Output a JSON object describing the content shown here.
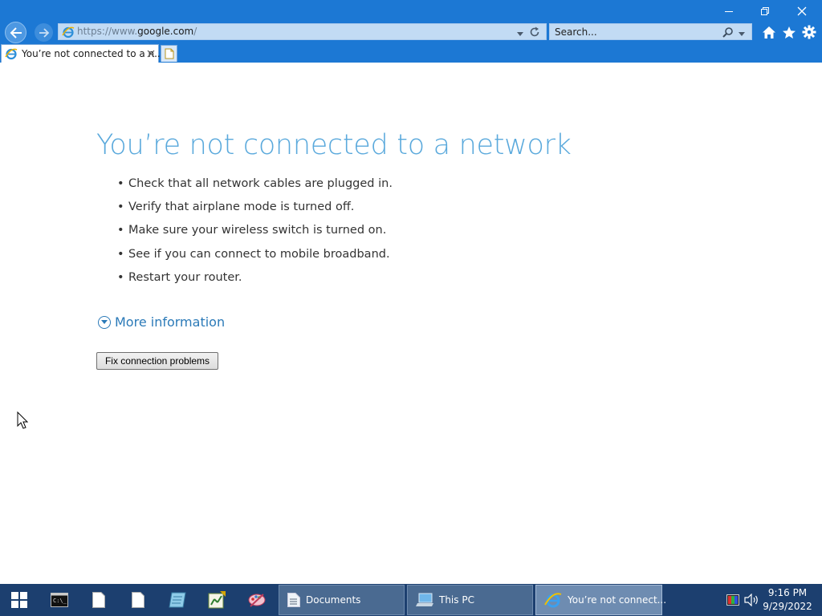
{
  "window": {
    "minimize_icon": "minimize-icon",
    "restore_icon": "restore-icon",
    "close_icon": "close-icon"
  },
  "toolbar": {
    "url_scheme": "https://www.",
    "url_host": "google.com",
    "url_path": "/",
    "search_placeholder": "Search...",
    "icons": [
      "back-arrow-icon",
      "forward-arrow-icon",
      "ie-icon",
      "dropdown-icon",
      "refresh-icon",
      "search-icon",
      "home-icon",
      "favorites-star-icon",
      "gear-icon"
    ]
  },
  "tab": {
    "label": "You’re not connected to a n...",
    "close_icon": "close-icon",
    "new_tab_icon": "new-tab-icon"
  },
  "page": {
    "title": "You’re not connected to a network",
    "tips": [
      "Check that all network cables are plugged in.",
      "Verify that airplane mode is turned off.",
      "Make sure your wireless switch is turned on.",
      "See if you can connect to mobile broadband.",
      "Restart your router."
    ],
    "more_info": "More information",
    "fix_button": "Fix connection problems"
  },
  "taskbar": {
    "pinned": [
      "windows-start-icon",
      "command-prompt-icon",
      "file-icon",
      "file-icon",
      "notepad-icon",
      "spreadsheet-icon",
      "paint-icon"
    ],
    "tasks": [
      {
        "label": "Documents",
        "icon": "document-icon",
        "active": false
      },
      {
        "label": "This PC",
        "icon": "computer-icon",
        "active": false
      },
      {
        "label": "You’re not connect...",
        "icon": "ie-icon",
        "active": true
      }
    ],
    "tray_icons": [
      "color-display-icon",
      "speaker-icon"
    ],
    "time": "9:16 PM",
    "date": "9/29/2022"
  },
  "colors": {
    "chrome_blue": "#1c78d4",
    "title_blue": "#5aa9dc",
    "link_blue": "#2b7ab8",
    "taskbar": "#1c3f6f"
  }
}
